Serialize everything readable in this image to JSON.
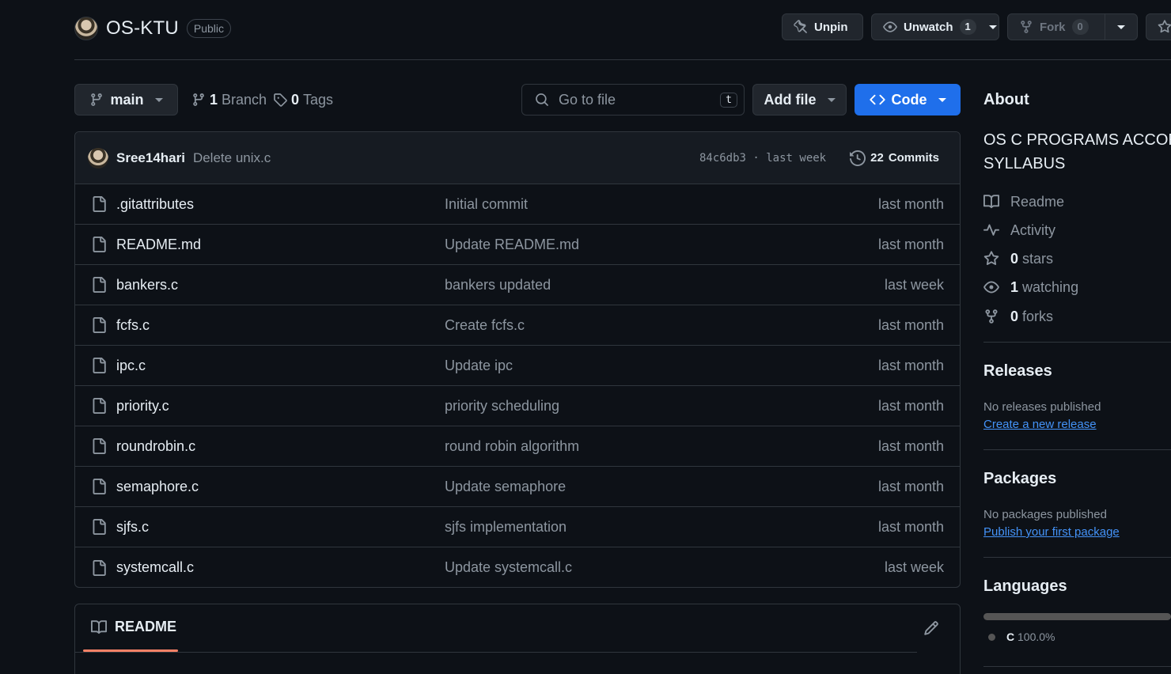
{
  "repo": {
    "name": "OS-KTU",
    "visibility": "Public"
  },
  "header_actions": {
    "unpin": "Unpin",
    "unwatch": "Unwatch",
    "watch_count": "1",
    "fork": "Fork",
    "fork_count": "0"
  },
  "toolbar": {
    "branch": "main",
    "branch_count": "1",
    "branch_label": "Branch",
    "tag_count": "0",
    "tag_label": "Tags",
    "search_placeholder": "Go to file",
    "search_kbd": "t",
    "add_file": "Add file",
    "code": "Code"
  },
  "latest_commit": {
    "author": "Sree14hari",
    "message": "Delete unix.c",
    "sha_time": "84c6db3 · last week",
    "commits_count": "22",
    "commits_label": "Commits"
  },
  "files": [
    {
      "name": ".gitattributes",
      "message": "Initial commit",
      "date": "last month"
    },
    {
      "name": "README.md",
      "message": "Update README.md",
      "date": "last month"
    },
    {
      "name": "bankers.c",
      "message": "bankers updated",
      "date": "last week"
    },
    {
      "name": "fcfs.c",
      "message": "Create fcfs.c",
      "date": "last month"
    },
    {
      "name": "ipc.c",
      "message": "Update ipc",
      "date": "last month"
    },
    {
      "name": "priority.c",
      "message": "priority scheduling",
      "date": "last month"
    },
    {
      "name": "roundrobin.c",
      "message": "round robin algorithm",
      "date": "last month"
    },
    {
      "name": "semaphore.c",
      "message": "Update semaphore",
      "date": "last month"
    },
    {
      "name": "sjfs.c",
      "message": "sjfs implementation",
      "date": "last month"
    },
    {
      "name": "systemcall.c",
      "message": "Update systemcall.c",
      "date": "last week"
    }
  ],
  "readme": {
    "tab": "README"
  },
  "about": {
    "title": "About",
    "description_line1": "OS C PROGRAMS ACCORD",
    "description_line2": "SYLLABUS",
    "readme": "Readme",
    "activity": "Activity",
    "stars_count": "0",
    "stars_label": "stars",
    "watching_count": "1",
    "watching_label": "watching",
    "forks_count": "0",
    "forks_label": "forks"
  },
  "releases": {
    "title": "Releases",
    "empty": "No releases published",
    "link": "Create a new release"
  },
  "packages": {
    "title": "Packages",
    "empty": "No packages published",
    "link": "Publish your first package"
  },
  "languages": {
    "title": "Languages",
    "name": "C",
    "percent": "100.0%",
    "color": "#555555"
  },
  "colors": {
    "accent_blue": "#1f6feb",
    "link": "#4493f8",
    "readme_underline": "#f78166"
  }
}
